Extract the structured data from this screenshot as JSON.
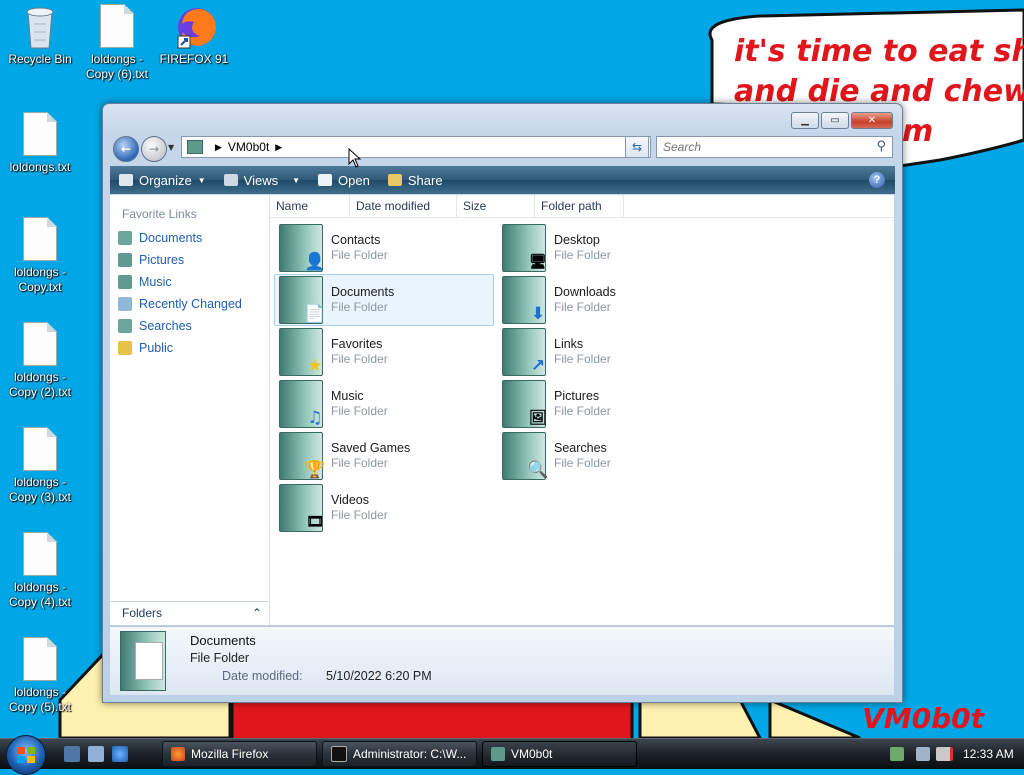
{
  "desktop": {
    "icons": [
      {
        "label": "Recycle Bin",
        "icon": "recycle-bin-icon"
      },
      {
        "label": "loldongs - Copy (6).txt",
        "icon": "text-file-icon"
      },
      {
        "label": "FIREFOX 91",
        "icon": "firefox-icon"
      },
      {
        "label": "loldongs.txt",
        "icon": "text-file-icon"
      },
      {
        "label": "loldongs - Copy.txt",
        "icon": "text-file-icon"
      },
      {
        "label": "loldongs - Copy (2).txt",
        "icon": "text-file-icon"
      },
      {
        "label": "loldongs - Copy (3).txt",
        "icon": "text-file-icon"
      },
      {
        "label": "loldongs - Copy (4).txt",
        "icon": "text-file-icon"
      },
      {
        "label": "loldongs - Copy (5).txt",
        "icon": "text-file-icon"
      }
    ],
    "wallpaper_text": [
      "it's time to eat shit",
      "and die and chew",
      "m"
    ],
    "signature": "VM0b0t"
  },
  "explorer": {
    "address": {
      "crumb": "VM0b0t"
    },
    "search": {
      "placeholder": "Search"
    },
    "toolbar": {
      "organize": "Organize",
      "views": "Views",
      "open": "Open",
      "share": "Share"
    },
    "favorite_links": {
      "title": "Favorite Links",
      "items": [
        "Documents",
        "Pictures",
        "Music",
        "Recently Changed",
        "Searches",
        "Public"
      ]
    },
    "folders_label": "Folders",
    "columns": [
      "Name",
      "Date modified",
      "Size",
      "Folder path"
    ],
    "items": [
      {
        "name": "Contacts",
        "type": "File Folder",
        "icon": "contacts-folder-icon"
      },
      {
        "name": "Desktop",
        "type": "File Folder",
        "icon": "desktop-folder-icon"
      },
      {
        "name": "Documents",
        "type": "File Folder",
        "icon": "documents-folder-icon",
        "selected": true
      },
      {
        "name": "Downloads",
        "type": "File Folder",
        "icon": "downloads-folder-icon"
      },
      {
        "name": "Favorites",
        "type": "File Folder",
        "icon": "favorites-folder-icon"
      },
      {
        "name": "Links",
        "type": "File Folder",
        "icon": "links-folder-icon"
      },
      {
        "name": "Music",
        "type": "File Folder",
        "icon": "music-folder-icon"
      },
      {
        "name": "Pictures",
        "type": "File Folder",
        "icon": "pictures-folder-icon"
      },
      {
        "name": "Saved Games",
        "type": "File Folder",
        "icon": "saved-games-folder-icon"
      },
      {
        "name": "Searches",
        "type": "File Folder",
        "icon": "searches-folder-icon"
      },
      {
        "name": "Videos",
        "type": "File Folder",
        "icon": "videos-folder-icon"
      }
    ],
    "details": {
      "name": "Documents",
      "type": "File Folder",
      "modified_label": "Date modified:",
      "modified_value": "5/10/2022 6:20 PM"
    }
  },
  "taskbar": {
    "buttons": [
      {
        "label": "Mozilla Firefox",
        "icon": "firefox-icon"
      },
      {
        "label": "Administrator: C:\\W...",
        "icon": "cmd-icon"
      },
      {
        "label": "VM0b0t",
        "icon": "folder-icon",
        "active": true
      }
    ],
    "clock": "12:33 AM"
  },
  "colors": {
    "desktop_bg": "#00a7e6",
    "wallpaper_red": "#e0161c",
    "link_blue": "#1e5fb3"
  }
}
